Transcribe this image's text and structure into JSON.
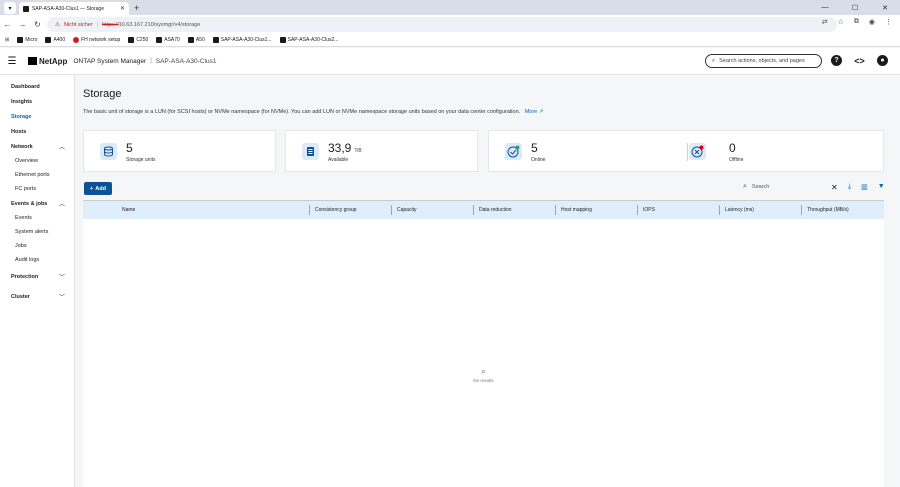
{
  "browser": {
    "tab_title": "SAP-ASA-A30-Clus1 — Storage",
    "insecure_label": "Nicht sicher",
    "url_protocol": "https://",
    "url_rest": "10.63.167.210/sysmgr/v4/storage",
    "bookmarks": [
      "Micro",
      "A400",
      "FH network setup",
      "C250",
      "ASA70",
      "A50",
      "SAP-ASA-A30-Clus1...",
      "SAP-ASA-A30-Clus2..."
    ]
  },
  "header": {
    "brand": "NetApp",
    "app_title": "ONTAP System Manager",
    "separator": "|",
    "cluster_name": "SAP-ASA-A30-Clus1",
    "search_placeholder": "Search actions, objects, and pages",
    "help_glyph": "?",
    "code_glyph": "<>"
  },
  "sidebar": {
    "dashboard": "Dashboard",
    "insights": "Insights",
    "storage": "Storage",
    "hosts": "Hosts",
    "network": "Network",
    "network_items": [
      "Overview",
      "Ethernet ports",
      "FC ports"
    ],
    "events_jobs": "Events & jobs",
    "events_items": [
      "Events",
      "System alerts",
      "Jobs",
      "Audit logs"
    ],
    "protection": "Protection",
    "cluster": "Cluster"
  },
  "main": {
    "title": "Storage",
    "description": "The basic unit of storage is a LUN (for SCSI hosts) or NVMe namespace (for NVMe). You can add LUN or NVMe namespace storage units based on your data center configuration.",
    "more_link": "More",
    "cards": {
      "units_value": "5",
      "units_label": "Storage units",
      "available_value": "33,9",
      "available_unit": "TiB",
      "available_label": "Available",
      "online_value": "5",
      "online_label": "Online",
      "offline_value": "0",
      "offline_label": "Offline"
    },
    "add_label": "Add",
    "search_placeholder": "Search",
    "columns": [
      "Name",
      "Consistency group",
      "Capacity",
      "Data reduction",
      "Host mapping",
      "IOPS",
      "Latency (ms)",
      "Throughput (MB/s)"
    ],
    "empty_text": "No results"
  }
}
